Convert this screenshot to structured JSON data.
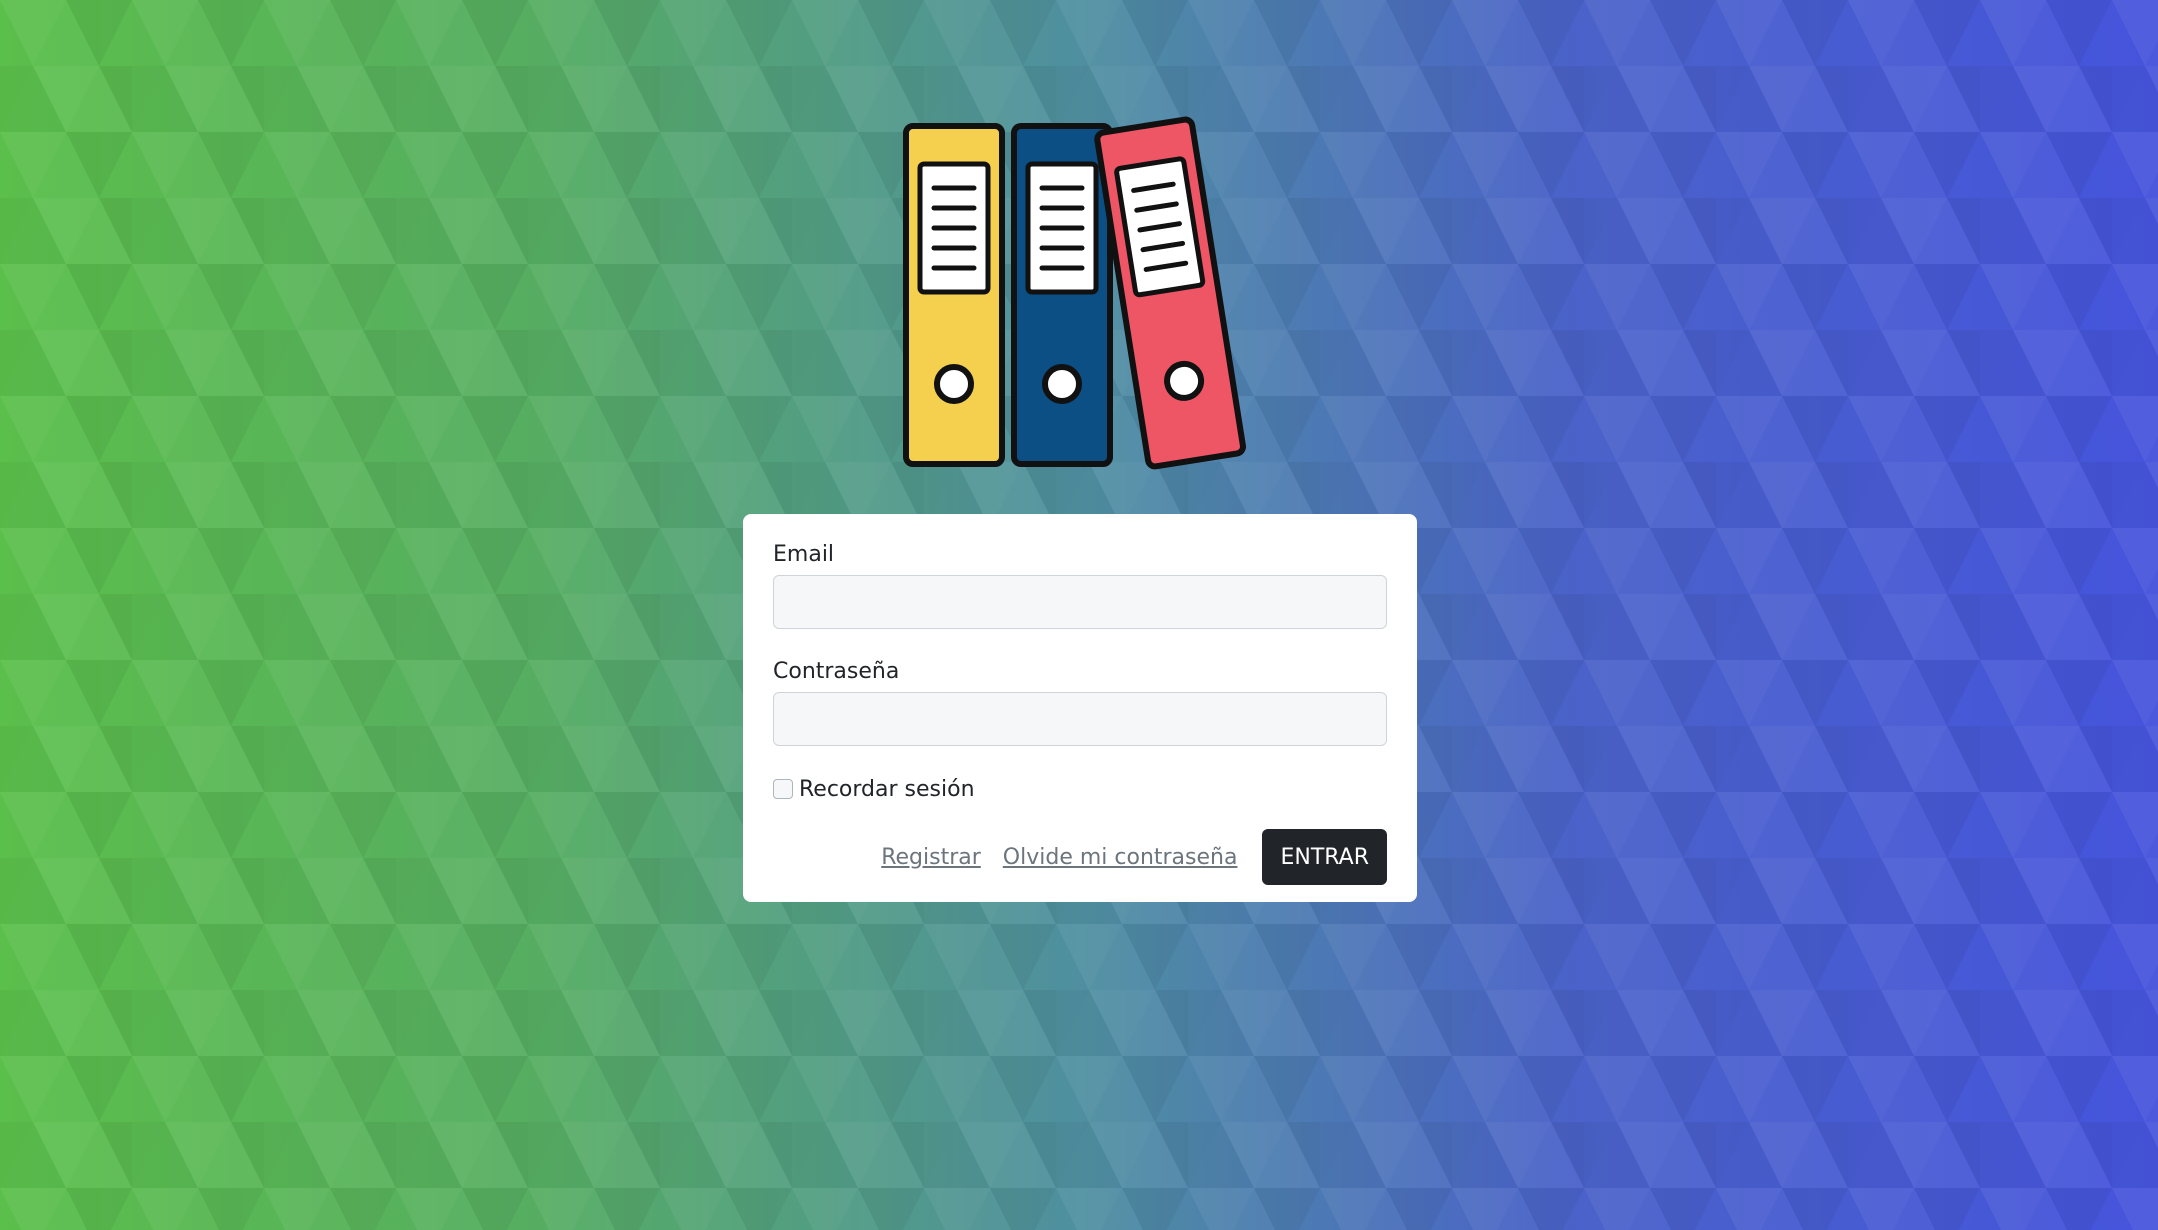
{
  "colors": {
    "binder_yellow": "#f5d04e",
    "binder_blue": "#0b4f84",
    "binder_red": "#ee5565",
    "button_bg": "#212529",
    "background_left": "#5bbf4b",
    "background_right": "#4654dc"
  },
  "logo": {
    "icon": "binders-icon"
  },
  "form": {
    "email": {
      "label": "Email",
      "value": "",
      "placeholder": ""
    },
    "password": {
      "label": "Contraseña",
      "value": "",
      "placeholder": ""
    },
    "remember": {
      "label": "Recordar sesión",
      "checked": false
    },
    "register_link": "Registrar",
    "forgot_link": "Olvide mi contraseña",
    "submit_label": "ENTRAR"
  }
}
